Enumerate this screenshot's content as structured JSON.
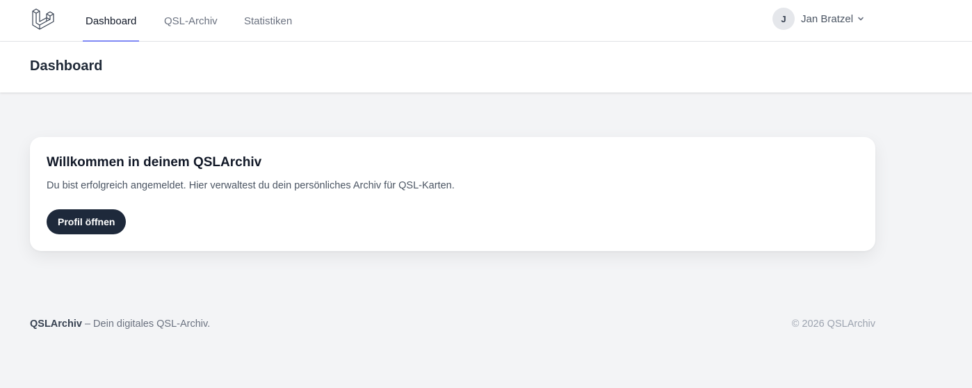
{
  "nav": {
    "logo_icon": "laravel-logo-icon",
    "links": [
      {
        "label": "Dashboard",
        "active": true
      },
      {
        "label": "QSL-Archiv",
        "active": false
      },
      {
        "label": "Statistiken",
        "active": false
      }
    ],
    "user": {
      "initial": "J",
      "name": "Jan Bratzel",
      "dropdown_icon": "chevron-down-icon"
    }
  },
  "header": {
    "title": "Dashboard"
  },
  "card": {
    "title": "Willkommen in deinem QSLArchiv",
    "text": "Du bist erfolgreich angemeldet. Hier verwaltest du dein persönliches Archiv für QSL-Karten.",
    "button_label": "Profil öffnen"
  },
  "footer": {
    "brand": "QSLArchiv",
    "tagline": " – Dein digitales QSL-Archiv.",
    "copyright": "© 2026 QSLArchiv"
  },
  "colors": {
    "accent": "#818cf8",
    "button_bg": "#1e293b",
    "page_bg": "#f3f4f6"
  }
}
